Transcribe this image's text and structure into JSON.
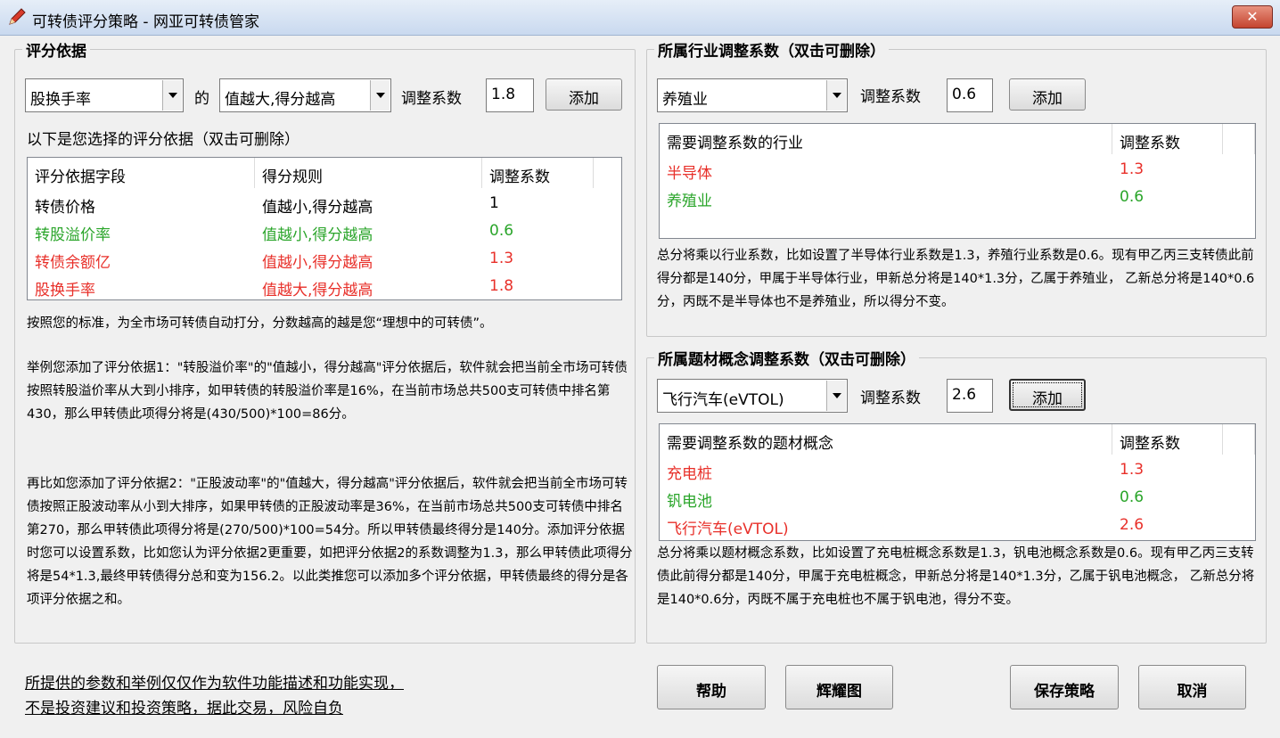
{
  "window": {
    "title": "可转债评分策略 - 网亚可转债管家"
  },
  "criteria": {
    "legend": "评分依据",
    "field_value": "股换手率",
    "of_label": "的",
    "rule_value": "值越大,得分越高",
    "coef_label": "调整系数",
    "coef_value": "1.8",
    "add_label": "添加",
    "list_caption": "以下是您选择的评分依据（双击可删除）",
    "columns": [
      "评分依据字段",
      "得分规则",
      "调整系数"
    ],
    "rows": [
      {
        "field": "转债价格",
        "rule": "值越小,得分越高",
        "coef": "1",
        "color": "#000000"
      },
      {
        "field": "转股溢价率",
        "rule": "值越小,得分越高",
        "coef": "0.6",
        "color": "#2aa52a"
      },
      {
        "field": "转债余额亿",
        "rule": "值越小,得分越高",
        "coef": "1.3",
        "color": "#e8302a"
      },
      {
        "field": "股换手率",
        "rule": "值越大,得分越高",
        "coef": "1.8",
        "color": "#e8302a"
      }
    ],
    "desc1": "按照您的标准，为全市场可转债自动打分，分数越高的越是您“理想中的可转债”。",
    "desc2": "举例您添加了评分依据1：\"转股溢价率\"的\"值越小，得分越高\"评分依据后，软件就会把当前全市场可转债按照转股溢价率从大到小排序，如甲转债的转股溢价率是16%，在当前市场总共500支可转债中排名第430，那么甲转债此项得分将是(430/500)*100=86分。",
    "desc3": "再比如您添加了评分依据2：\"正股波动率\"的\"值越大，得分越高\"评分依据后，软件就会把当前全市场可转债按照正股波动率从小到大排序，如果甲转债的正股波动率是36%，在当前市场总共500支可转债中排名第270，那么甲转债此项得分将是(270/500)*100=54分。所以甲转债最终得分是140分。添加评分依据时您可以设置系数，比如您认为评分依据2更重要，如把评分依据2的系数调整为1.3，那么甲转债此项得分将是54*1.3,最终甲转债得分总和变为156.2。以此类推您可以添加多个评分依据，甲转债最终的得分是各项评分依据之和。"
  },
  "industry": {
    "legend": "所属行业调整系数（双击可删除）",
    "select_value": "养殖业",
    "coef_label": "调整系数",
    "coef_value": "0.6",
    "add_label": "添加",
    "columns": [
      "需要调整系数的行业",
      "调整系数"
    ],
    "rows": [
      {
        "name": "半导体",
        "coef": "1.3",
        "color": "#e8302a"
      },
      {
        "name": "养殖业",
        "coef": "0.6",
        "color": "#2aa52a"
      }
    ],
    "desc": "总分将乘以行业系数，比如设置了半导体行业系数是1.3，养殖行业系数是0.6。现有甲乙丙三支转债此前得分都是140分，甲属于半导体行业，甲新总分将是140*1.3分，乙属于养殖业， 乙新总分将是140*0.6分，丙既不是半导体也不是养殖业，所以得分不变。"
  },
  "theme": {
    "legend": "所属题材概念调整系数（双击可删除）",
    "select_value": "飞行汽车(eVTOL)",
    "coef_label": "调整系数",
    "coef_value": "2.6",
    "add_label": "添加",
    "columns": [
      "需要调整系数的题材概念",
      "调整系数"
    ],
    "rows": [
      {
        "name": "充电桩",
        "coef": "1.3",
        "color": "#e8302a"
      },
      {
        "name": "钒电池",
        "coef": "0.6",
        "color": "#2aa52a"
      },
      {
        "name": "飞行汽车(eVTOL)",
        "coef": "2.6",
        "color": "#e8302a"
      }
    ],
    "desc": "总分将乘以题材概念系数，比如设置了充电桩概念系数是1.3，钒电池概念系数是0.6。现有甲乙丙三支转债此前得分都是140分，甲属于充电桩概念，甲新总分将是140*1.3分，乙属于钒电池概念， 乙新总分将是140*0.6分，丙既不属于充电桩也不属于钒电池，得分不变。"
  },
  "footer": {
    "disclaimer_line1": "所提供的参数和举例仅仅作为软件功能描述和功能实现，",
    "disclaimer_line2": "不是投资建议和投资策略，据此交易，风险自负",
    "help_label": "帮助",
    "chart_label": "辉耀图",
    "save_label": "保存策略",
    "cancel_label": "取消"
  }
}
